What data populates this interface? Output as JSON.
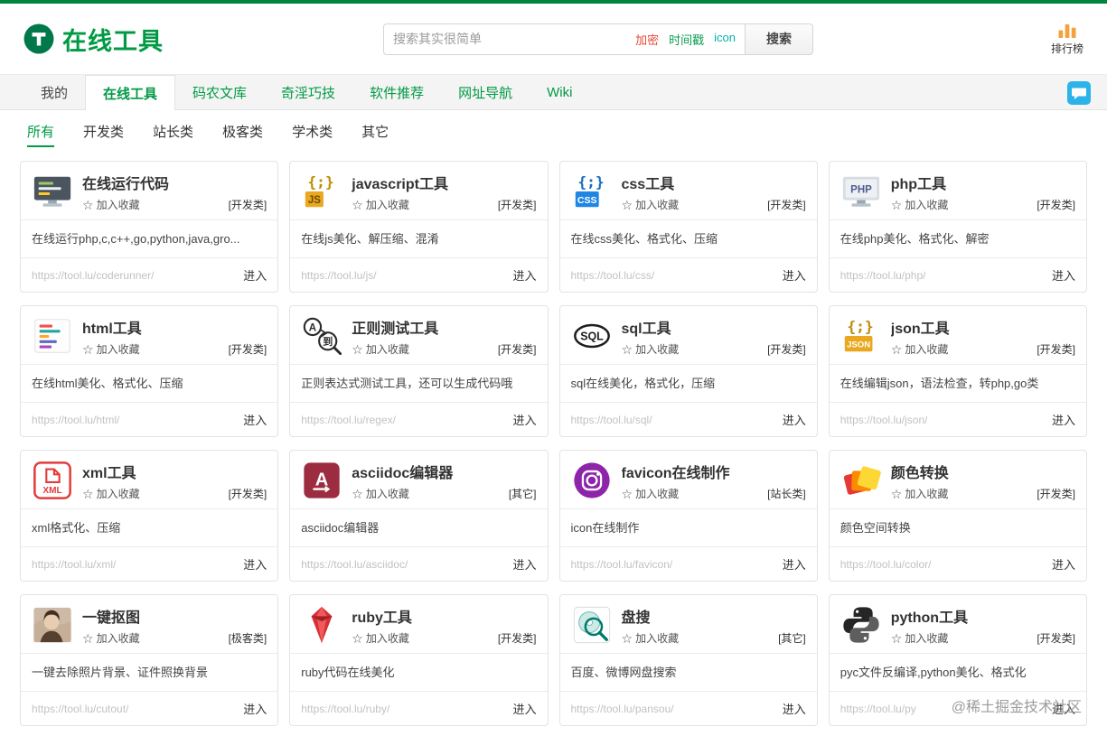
{
  "page": {
    "watermark": "@稀土掘金技术社区"
  },
  "colors": {
    "brand_green": "#009a44",
    "top_border": "#00843d",
    "chat_blue": "#2bb3ea",
    "ranking_gold": "#f2a33c"
  },
  "header": {
    "logo": {
      "text": "在线工具",
      "icon": "logo-t-icon"
    },
    "search": {
      "placeholder": "搜索其实很简单",
      "hot_tags": [
        {
          "label": "加密",
          "color": "#e74c3c"
        },
        {
          "label": "时间戳",
          "color": "#0a9d4f"
        },
        {
          "label": "icon",
          "color": "#00b5ad"
        }
      ],
      "button_label": "搜索"
    },
    "ranking_label": "排行榜",
    "ranking_icon": "bar-chart-icon"
  },
  "nav": {
    "tabs": [
      {
        "label": "我的",
        "active": false
      },
      {
        "label": "在线工具",
        "active": true
      },
      {
        "label": "码农文库",
        "active": false
      },
      {
        "label": "奇淫巧技",
        "active": false
      },
      {
        "label": "软件推荐",
        "active": false
      },
      {
        "label": "网址导航",
        "active": false
      },
      {
        "label": "Wiki",
        "active": false
      }
    ],
    "chat_icon": "chat-icon"
  },
  "filters": {
    "items": [
      {
        "label": "所有",
        "active": true
      },
      {
        "label": "开发类",
        "active": false
      },
      {
        "label": "站长类",
        "active": false
      },
      {
        "label": "极客类",
        "active": false
      },
      {
        "label": "学术类",
        "active": false
      },
      {
        "label": "其它",
        "active": false
      }
    ]
  },
  "card_common": {
    "favorite_star": "☆",
    "favorite_label": "加入收藏",
    "enter_label": "进入"
  },
  "cards": [
    {
      "title": "在线运行代码",
      "category": "[开发类]",
      "desc": "在线运行php,c,c++,go,python,java,gro...",
      "url": "https://tool.lu/coderunner/",
      "icon": "code-runner-icon"
    },
    {
      "title": "javascript工具",
      "category": "[开发类]",
      "desc": "在线js美化、解压缩、混淆",
      "url": "https://tool.lu/js/",
      "icon": "javascript-icon"
    },
    {
      "title": "css工具",
      "category": "[开发类]",
      "desc": "在线css美化、格式化、压缩",
      "url": "https://tool.lu/css/",
      "icon": "css-icon"
    },
    {
      "title": "php工具",
      "category": "[开发类]",
      "desc": "在线php美化、格式化、解密",
      "url": "https://tool.lu/php/",
      "icon": "php-icon"
    },
    {
      "title": "html工具",
      "category": "[开发类]",
      "desc": "在线html美化、格式化、压缩",
      "url": "https://tool.lu/html/",
      "icon": "html-icon"
    },
    {
      "title": "正则测试工具",
      "category": "[开发类]",
      "desc": "正则表达式测试工具，还可以生成代码哦",
      "url": "https://tool.lu/regex/",
      "icon": "regex-icon"
    },
    {
      "title": "sql工具",
      "category": "[开发类]",
      "desc": "sql在线美化，格式化，压缩",
      "url": "https://tool.lu/sql/",
      "icon": "sql-icon"
    },
    {
      "title": "json工具",
      "category": "[开发类]",
      "desc": "在线编辑json，语法检查，转php,go类",
      "url": "https://tool.lu/json/",
      "icon": "json-icon"
    },
    {
      "title": "xml工具",
      "category": "[开发类]",
      "desc": "xml格式化、压缩",
      "url": "https://tool.lu/xml/",
      "icon": "xml-icon"
    },
    {
      "title": "asciidoc编辑器",
      "category": "[其它]",
      "desc": "asciidoc编辑器",
      "url": "https://tool.lu/asciidoc/",
      "icon": "asciidoc-icon"
    },
    {
      "title": "favicon在线制作",
      "category": "[站长类]",
      "desc": "icon在线制作",
      "url": "https://tool.lu/favicon/",
      "icon": "favicon-icon"
    },
    {
      "title": "颜色转换",
      "category": "[开发类]",
      "desc": "颜色空间转换",
      "url": "https://tool.lu/color/",
      "icon": "color-convert-icon"
    },
    {
      "title": "一键抠图",
      "category": "[极客类]",
      "desc": "一键去除照片背景、证件照换背景",
      "url": "https://tool.lu/cutout/",
      "icon": "photo-cutout-icon"
    },
    {
      "title": "ruby工具",
      "category": "[开发类]",
      "desc": "ruby代码在线美化",
      "url": "https://tool.lu/ruby/",
      "icon": "ruby-icon"
    },
    {
      "title": "盘搜",
      "category": "[其它]",
      "desc": "百度、微博网盘搜索",
      "url": "https://tool.lu/pansou/",
      "icon": "pan-search-icon"
    },
    {
      "title": "python工具",
      "category": "[开发类]",
      "desc": "pyc文件反编译,python美化、格式化",
      "url": "https://tool.lu/py",
      "icon": "python-icon"
    }
  ]
}
